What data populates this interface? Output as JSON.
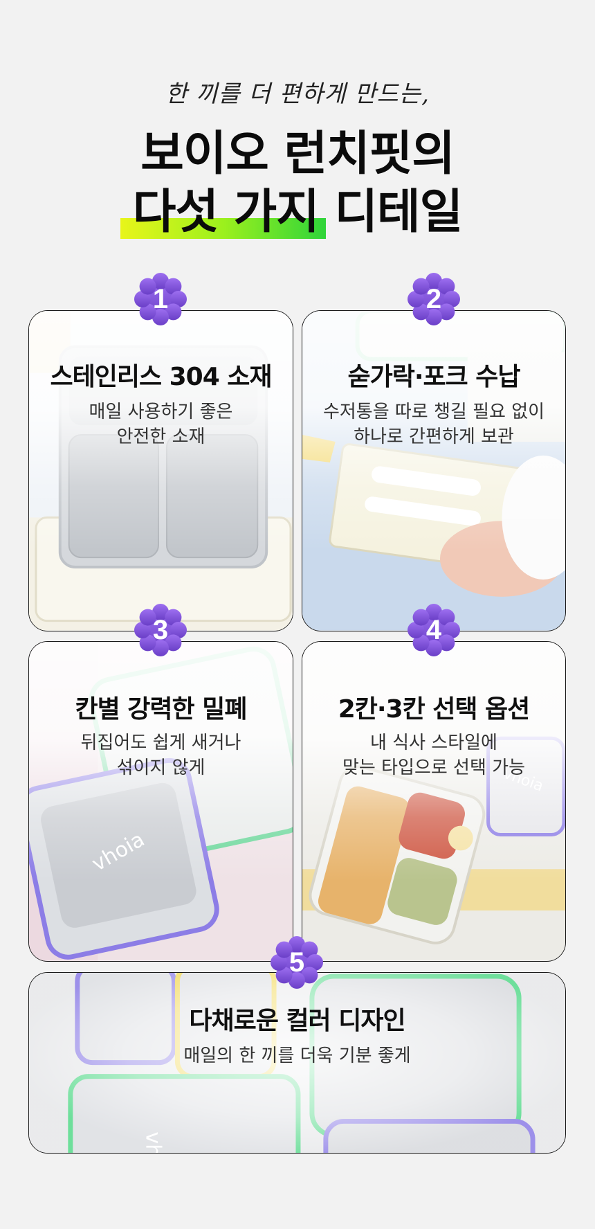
{
  "header": {
    "subtitle": "한 끼를 더 편하게 만드는,",
    "title_line1": "보이오 런치핏의",
    "title_highlight": "다섯 가지",
    "title_line2_rest": " 디테일"
  },
  "colors": {
    "badge": "#7a4fd3",
    "badge_light": "#9d6ff0",
    "highlight_start": "#e8f51a",
    "highlight_end": "#2fd43a",
    "lid_green": "#55d98a",
    "lid_purple": "#8a7be8",
    "lid_yellow": "#f1d54a"
  },
  "features": [
    {
      "number": "1",
      "title": "스테인리스 304 소재",
      "desc_line1": "매일 사용하기 좋은",
      "desc_line2": "안전한 소재",
      "logo_text": ""
    },
    {
      "number": "2",
      "title": "숟가락·포크 수납",
      "desc_line1": "수저통을 따로 챙길 필요 없이",
      "desc_line2": "하나로 간편하게 보관",
      "logo_text": ""
    },
    {
      "number": "3",
      "title": "칸별 강력한 밀폐",
      "desc_line1": "뒤집어도 쉽게 새거나",
      "desc_line2": "섞이지 않게",
      "logo_text": "vhoia"
    },
    {
      "number": "4",
      "title": "2칸·3칸 선택 옵션",
      "desc_line1": "내 식사 스타일에",
      "desc_line2": "맞는 타입으로 선택 가능",
      "logo_text": "vhoia"
    },
    {
      "number": "5",
      "title": "다채로운 컬러 디자인",
      "desc_line1": "매일의 한 끼를 더욱 기분 좋게",
      "desc_line2": "",
      "logo_text": "vhoia"
    }
  ]
}
